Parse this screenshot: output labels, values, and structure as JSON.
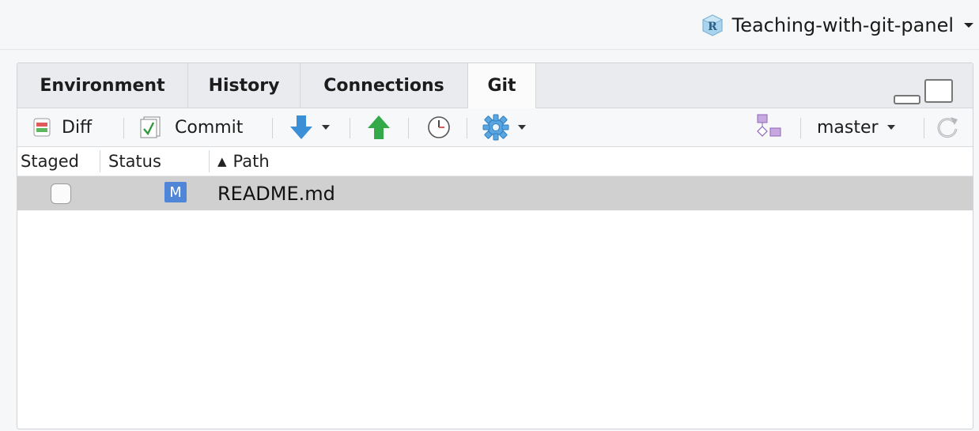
{
  "project": {
    "name": "Teaching-with-git-panel",
    "icon": "r-project-icon"
  },
  "tabs": [
    {
      "label": "Environment",
      "active": false
    },
    {
      "label": "History",
      "active": false
    },
    {
      "label": "Connections",
      "active": false
    },
    {
      "label": "Git",
      "active": true
    }
  ],
  "toolbar": {
    "diff_label": "Diff",
    "commit_label": "Commit",
    "pull_icon": "pull-arrow-down-icon",
    "push_icon": "push-arrow-up-icon",
    "history_icon": "clock-icon",
    "more_icon": "gear-icon",
    "new_branch_icon": "branch-icon",
    "branch_label": "master",
    "refresh_icon": "refresh-icon"
  },
  "table": {
    "columns": {
      "staged": "Staged",
      "status": "Status",
      "path": "Path"
    },
    "sort_indicator": "▲",
    "rows": [
      {
        "staged": false,
        "status": "M",
        "path": "README.md"
      }
    ]
  },
  "colors": {
    "status_modified": "#4f86d8",
    "pull_arrow": "#3a8fd6",
    "push_arrow": "#33a94a",
    "selected_row": "#d0d0d0"
  }
}
